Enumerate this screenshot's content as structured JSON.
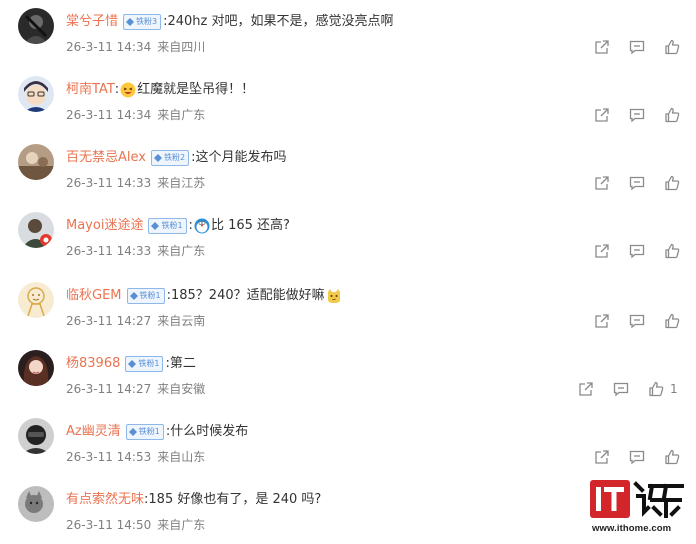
{
  "comments": [
    {
      "user": "棠兮子惜",
      "badge": "铁粉3",
      "text": ":240hz 对吧，如果不是，感觉没亮点啊",
      "emoji": null,
      "time": "26-3-11 14:34",
      "location": "来自四川",
      "likes": ""
    },
    {
      "user": "柯南TAT",
      "badge": "",
      "text_before": ":",
      "emoji": "laughing-emoji",
      "text": "红魔就是坠吊得！！",
      "time": "26-3-11 14:34",
      "location": "来自广东",
      "likes": ""
    },
    {
      "user": "百无禁忌Alex",
      "badge": "铁粉2",
      "text": ":这个月能发布吗",
      "emoji": null,
      "time": "26-3-11 14:33",
      "location": "来自江苏",
      "likes": ""
    },
    {
      "user": "Mayoi迷途途",
      "badge": "铁粉1",
      "text_before": ":",
      "emoji": "doraemon-emoji",
      "text": "比 165 还高?",
      "time": "26-3-11 14:33",
      "location": "来自广东",
      "likes": ""
    },
    {
      "user": "临秋GEM",
      "badge": "铁粉1",
      "text": ":185？240？适配能做好嘛",
      "emoji_after": "cat-emoji",
      "time": "26-3-11 14:27",
      "location": "来自云南",
      "likes": ""
    },
    {
      "user": "杨83968",
      "badge": "铁粉1",
      "text": ":第二",
      "emoji": null,
      "time": "26-3-11 14:27",
      "location": "来自安徽",
      "likes": "1"
    },
    {
      "user": "Az幽灵清",
      "badge": "铁粉1",
      "text": ":什么时候发布",
      "emoji": null,
      "time": "26-3-11 14:53",
      "location": "来自山东",
      "likes": ""
    },
    {
      "user": "有点索然无味",
      "badge": "",
      "text": ":185 好像也有了，是 240 吗?",
      "emoji": null,
      "time": "26-3-11 14:50",
      "location": "来自广东",
      "likes": ""
    }
  ],
  "watermark": {
    "mark": "IT之家",
    "url": "www.ithome.com"
  },
  "colors": {
    "username": "#eb7350",
    "meta": "#808080",
    "text": "#333333",
    "badge_border": "#8fb7e8",
    "badge_text": "#5a8fd6",
    "icon": "#8a8a8a",
    "logo_red": "#d2262b"
  },
  "icons": {
    "share": "share-icon",
    "comment": "comment-icon",
    "like": "like-icon"
  }
}
